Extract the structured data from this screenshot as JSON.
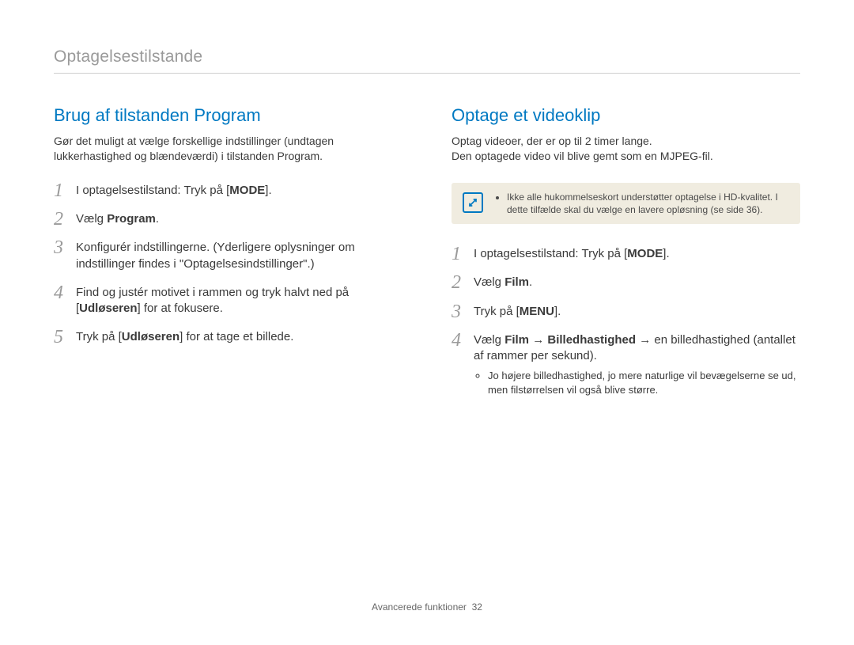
{
  "header": {
    "title": "Optagelsestilstande"
  },
  "left": {
    "title": "Brug af tilstanden Program",
    "intro": "Gør det muligt at vælge forskellige indstillinger (undtagen lukkerhastighed og blændeværdi) i tilstanden Program.",
    "steps": {
      "s1a": "I optagelsestilstand: Tryk på [",
      "s1b": "MODE",
      "s1c": "].",
      "s2a": "Vælg ",
      "s2b": "Program",
      "s2c": ".",
      "s3": "Konfigurér indstillingerne. (Yderligere oplysninger om indstillinger findes i \"Optagelsesindstillinger\".)",
      "s4a": "Find og justér motivet i rammen og tryk halvt ned på [",
      "s4b": "Udløseren",
      "s4c": "] for at fokusere.",
      "s5a": "Tryk på [",
      "s5b": "Udløseren",
      "s5c": "] for at tage et billede."
    }
  },
  "right": {
    "title": "Optage et videoklip",
    "intro": "Optag videoer, der er op til 2 timer lange.\nDen optagede video vil blive gemt som en MJPEG-fil.",
    "note": "Ikke alle hukommelseskort understøtter optagelse i HD-kvalitet. I dette tilfælde skal du vælge en lavere opløsning (se side 36).",
    "steps": {
      "s1a": "I optagelsestilstand: Tryk på [",
      "s1b": "MODE",
      "s1c": "].",
      "s2a": "Vælg ",
      "s2b": "Film",
      "s2c": ".",
      "s3a": "Tryk på [",
      "s3b": "MENU",
      "s3c": "].",
      "s4a": "Vælg ",
      "s4b": "Film",
      "s4c": " → ",
      "s4d": "Billedhastighed",
      "s4e": " → en billedhastighed (antallet af rammer per sekund).",
      "s4note": "Jo højere billedhastighed, jo mere naturlige vil bevægelserne se ud, men filstørrelsen vil også blive større."
    }
  },
  "footer": {
    "section": "Avancerede funktioner",
    "page": "32"
  }
}
